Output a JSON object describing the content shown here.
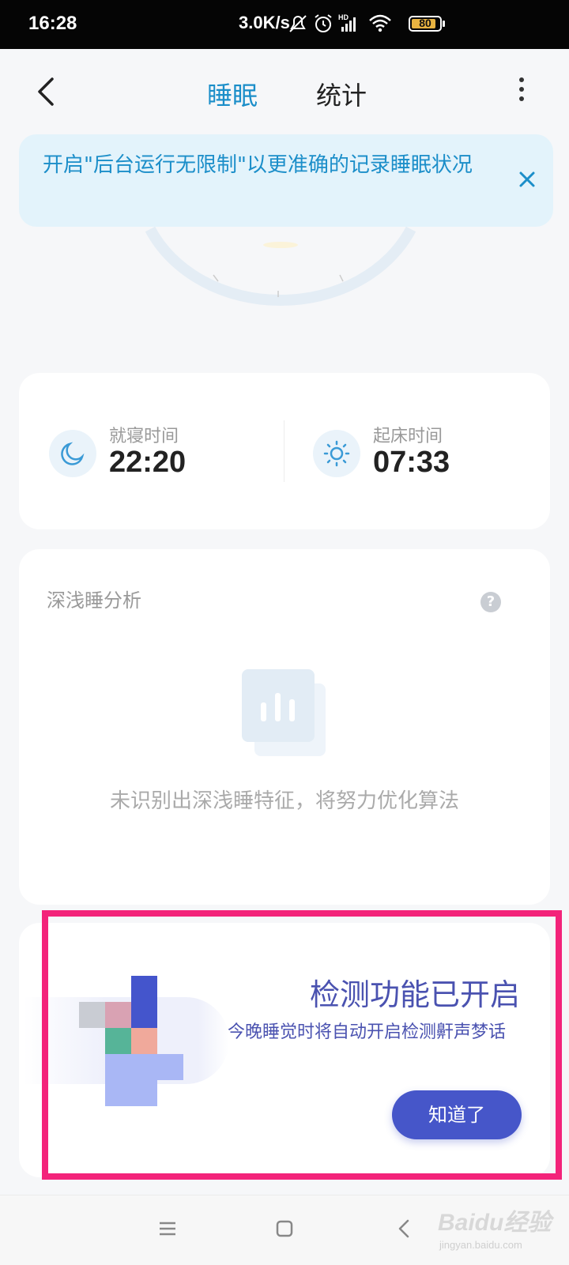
{
  "status_bar": {
    "time": "16:28",
    "net_speed": "3.0K/s",
    "battery_level": "80",
    "icons": [
      "mute-bell-icon",
      "alarm-icon",
      "hd-signal-icon",
      "wifi-icon",
      "battery-icon"
    ]
  },
  "header": {
    "tab_sleep": "睡眠",
    "tab_stats": "统计",
    "active_tab": "睡眠"
  },
  "banner": {
    "text": "开启\"后台运行无限制\"以更准确的记录睡眠状况"
  },
  "sleep_times": {
    "bedtime_label": "就寝时间",
    "bedtime_value": "22:20",
    "wake_label": "起床时间",
    "wake_value": "07:33"
  },
  "analysis": {
    "title": "深浅睡分析",
    "help_glyph": "?",
    "empty_message": "未识别出深浅睡特征，将努力优化算法"
  },
  "detect_dialog": {
    "title": "检测功能已开启",
    "description": "今晚睡觉时将自动开启检测鼾声梦话",
    "button": "知道了"
  },
  "watermark": {
    "logo": "Baidu经验",
    "url": "jingyan.baidu.com"
  },
  "colors": {
    "accent_blue": "#1b8ec9",
    "dialog_text": "#4a52b0",
    "button_bg": "#4656c9",
    "highlight_frame": "#f3237a"
  }
}
